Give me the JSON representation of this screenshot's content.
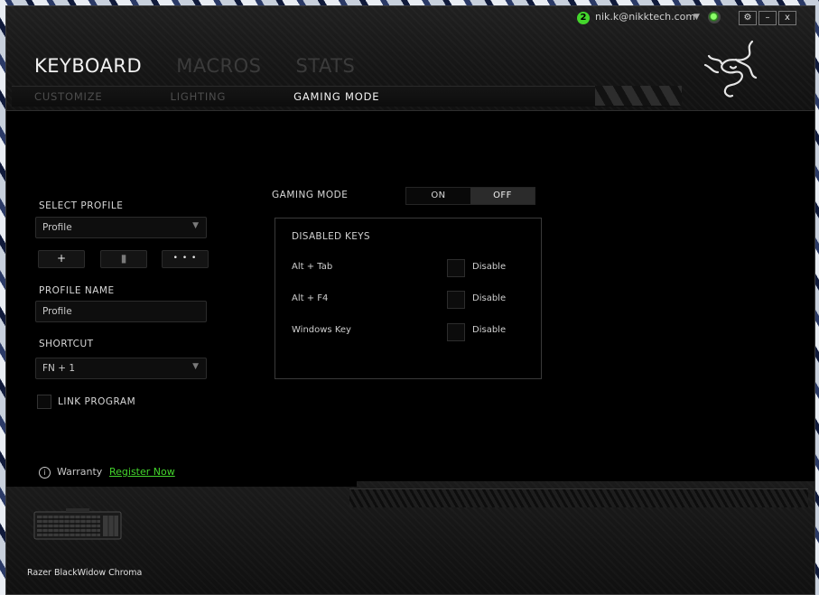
{
  "header": {
    "user": {
      "badge_count": "2",
      "email": "nik.k@nikktech.com"
    },
    "window_buttons": {
      "settings": "⚙",
      "minimize": "–",
      "close": "x"
    },
    "main_tabs": [
      {
        "label": "KEYBOARD",
        "active": true
      },
      {
        "label": "MACROS",
        "active": false
      },
      {
        "label": "STATS",
        "active": false
      }
    ],
    "sub_tabs": [
      {
        "label": "CUSTOMIZE",
        "active": false
      },
      {
        "label": "LIGHTING",
        "active": false
      },
      {
        "label": "GAMING MODE",
        "active": true
      }
    ]
  },
  "profile": {
    "select_label": "SELECT PROFILE",
    "selected": "Profile",
    "add_label": "+",
    "delete_label": "▮",
    "more_label": "• • •",
    "name_label": "PROFILE NAME",
    "name_value": "Profile",
    "shortcut_label": "SHORTCUT",
    "shortcut_value": "FN + 1",
    "link_program_label": "LINK PROGRAM"
  },
  "gaming_mode": {
    "label": "GAMING MODE",
    "on_label": "ON",
    "off_label": "OFF",
    "state": "OFF"
  },
  "disabled_keys": {
    "title": "DISABLED KEYS",
    "rows": [
      {
        "key": "Alt + Tab",
        "action": "Disable"
      },
      {
        "key": "Alt + F4",
        "action": "Disable"
      },
      {
        "key": "Windows Key",
        "action": "Disable"
      }
    ]
  },
  "warranty": {
    "label": "Warranty",
    "link": "Register Now"
  },
  "device": {
    "name": "Razer BlackWidow Chroma"
  },
  "colors": {
    "accent": "#44d62c",
    "background": "#000000",
    "panel_border": "#3a3a3a"
  }
}
